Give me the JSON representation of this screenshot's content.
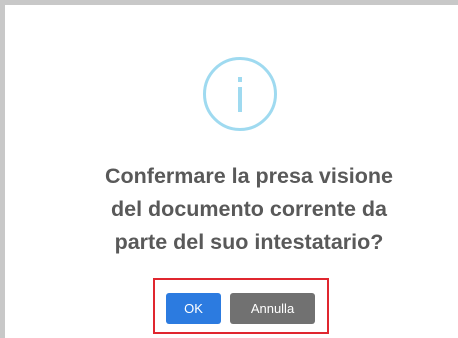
{
  "dialog": {
    "icon": "info-icon",
    "message_lines": [
      "Confermare la presa visione",
      "del documento corrente da",
      "parte del suo intestatario?"
    ],
    "ok_label": "OK",
    "cancel_label": "Annulla"
  },
  "colors": {
    "icon_ring": "#9fdaf0",
    "message_text": "#595959",
    "ok_button": "#2c7be0",
    "cancel_button": "#717171",
    "highlight_box": "#e0262f",
    "frame_border": "#c8c8c8"
  }
}
